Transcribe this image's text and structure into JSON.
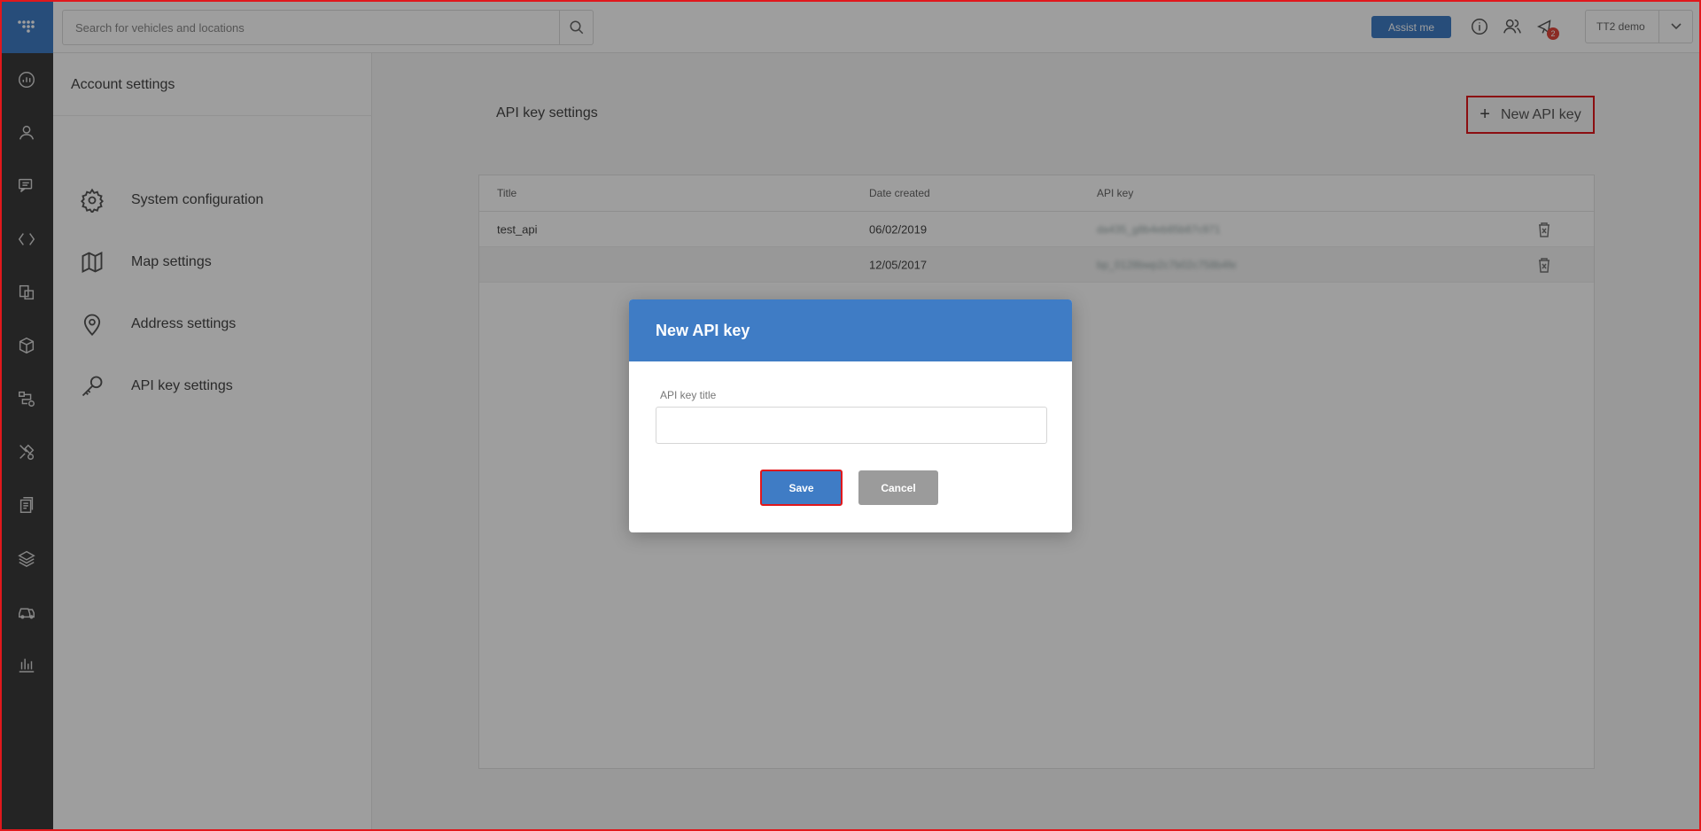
{
  "search": {
    "placeholder": "Search for vehicles and locations"
  },
  "topbar": {
    "assist_label": "Assist me",
    "notification_count": "2",
    "account_name": "TT2 demo"
  },
  "rail": {
    "icons": [
      "dashboard-icon",
      "user-icon",
      "chat-icon",
      "sync-icon",
      "documents-icon",
      "package-icon",
      "route-icon",
      "tools-icon",
      "reports-icon",
      "layers-icon",
      "vehicles-icon",
      "statistics-icon"
    ]
  },
  "settings_sidebar": {
    "title": "Account settings",
    "items": [
      {
        "label": "System configuration",
        "icon": "gear-icon"
      },
      {
        "label": "Map settings",
        "icon": "map-icon"
      },
      {
        "label": "Address settings",
        "icon": "location-pin-icon"
      },
      {
        "label": "API key settings",
        "icon": "key-icon"
      }
    ]
  },
  "main": {
    "title": "API key settings",
    "new_button_label": "New API key",
    "table": {
      "headers": [
        "Title",
        "Date created",
        "API key"
      ],
      "rows": [
        {
          "title": "test_api",
          "date": "06/02/2019",
          "key": "da435_g8b4eb85b87c971"
        },
        {
          "title": "",
          "date": "12/05/2017",
          "key": "bp_0128bwp2c7b02c758b4fe"
        }
      ]
    }
  },
  "modal": {
    "title": "New API key",
    "field_label": "API key title",
    "field_value": "",
    "save_label": "Save",
    "cancel_label": "Cancel"
  },
  "colors": {
    "brand_blue": "#3f7cc5",
    "highlight_red": "#e0181c",
    "rail_dark": "#3a3a3a"
  }
}
